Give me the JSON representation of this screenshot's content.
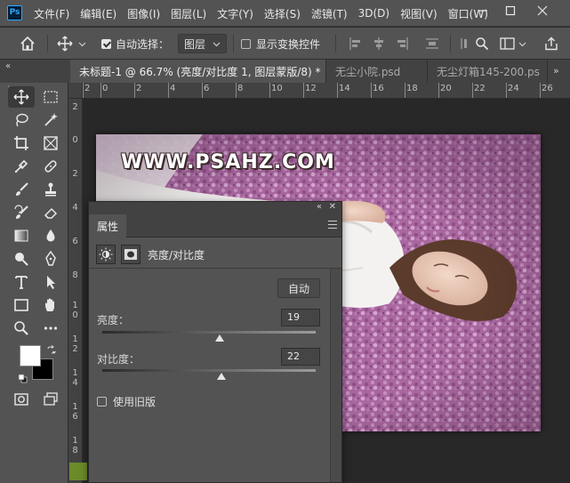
{
  "app": {
    "logo_text": "Ps"
  },
  "menu": [
    "文件(F)",
    "编辑(E)",
    "图像(I)",
    "图层(L)",
    "文字(Y)",
    "选择(S)",
    "滤镜(T)",
    "3D(D)",
    "视图(V)",
    "窗口(W)"
  ],
  "options": {
    "auto_select_label": "自动选择：",
    "auto_select_checked": true,
    "layer_dropdown": "图层",
    "show_transform_label": "显示变换控件",
    "show_transform_checked": false
  },
  "tabs": [
    {
      "label": "未标题-1 @ 66.7% (亮度/对比度 1, 图层蒙版/8) *",
      "active": true
    },
    {
      "label": "无尘小院.psd",
      "active": false
    },
    {
      "label": "无尘灯箱145-200.ps",
      "active": false
    }
  ],
  "ruler_top": [
    "2",
    "0",
    "2",
    "4",
    "6",
    "8",
    "10",
    "12",
    "14",
    "16",
    "18",
    "20",
    "22",
    "24",
    "26"
  ],
  "ruler_left": [
    "2",
    "0",
    "2",
    "4",
    "6",
    "8",
    "1 0",
    "1 2",
    "1 4",
    "1 6",
    "1 8"
  ],
  "canvas": {
    "watermark": "WWW.PSAHZ.COM"
  },
  "properties_panel": {
    "title": "属性",
    "adjustment_name": "亮度/对比度",
    "auto_button": "自动",
    "brightness_label": "亮度：",
    "brightness_value": "19",
    "brightness_level": 0.55,
    "contrast_label": "对比度：",
    "contrast_value": "22",
    "contrast_level": 0.56,
    "use_legacy_label": "使用旧版",
    "use_legacy_checked": false
  },
  "colors": {
    "foreground": "#ffffff",
    "background": "#000000",
    "ui_dark": "#535353",
    "ui_darker": "#424242"
  }
}
